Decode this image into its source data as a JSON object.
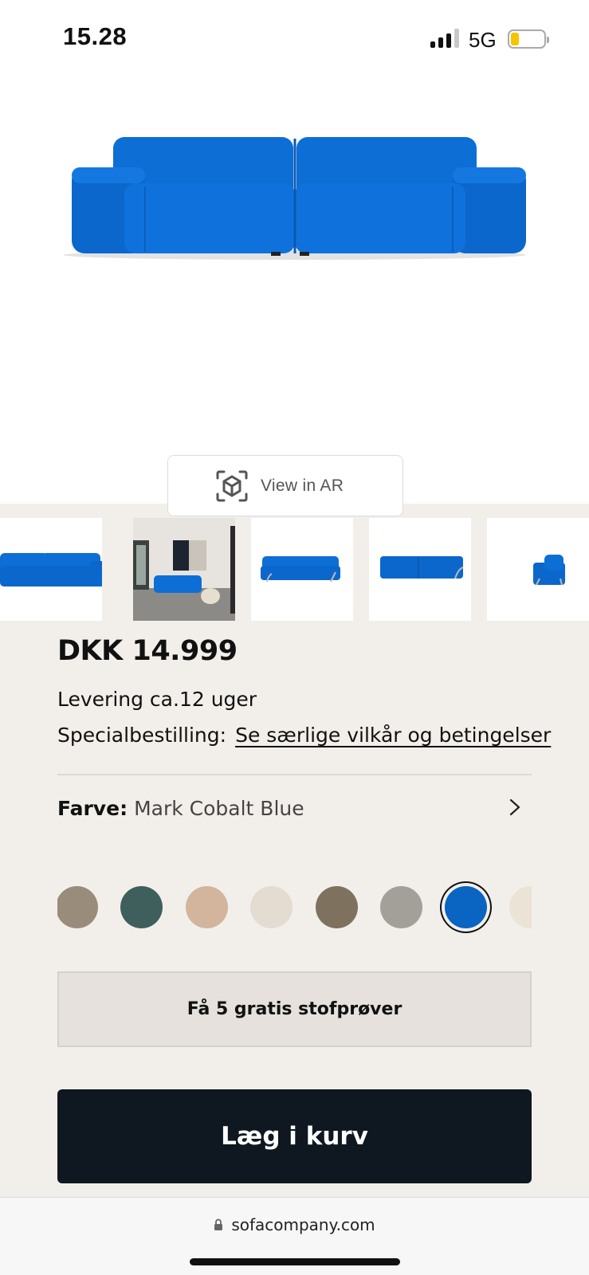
{
  "status_bar": {
    "time": "15.28",
    "network": "5G",
    "battery_level": 0.25,
    "signal_bars": 3,
    "battery_color": "#f6c400"
  },
  "product": {
    "sofa_color": "#0a6fd4",
    "ar_button": {
      "label": "View in AR",
      "icon": "ar-cube-icon"
    },
    "thumbnails": [
      {
        "name": "sofa-front-view"
      },
      {
        "name": "sofa-living-room"
      },
      {
        "name": "sofa-angle-view"
      },
      {
        "name": "sofa-back-view"
      },
      {
        "name": "sofa-side-view"
      }
    ],
    "price": "DKK 14.999",
    "delivery": "Levering ca.12 uger",
    "special_order": {
      "label": "Specialbestilling:",
      "link": "Se særlige vilkår og betingelser"
    },
    "color": {
      "label": "Farve:",
      "value": "Mark Cobalt Blue",
      "icon": "chevron-right-icon"
    },
    "swatches": [
      {
        "name": "taupe",
        "color": "#9a8c7b",
        "selected": false
      },
      {
        "name": "dark-green",
        "color": "#3f5f5c",
        "selected": false
      },
      {
        "name": "sand",
        "color": "#d2b59c",
        "selected": false
      },
      {
        "name": "light-beige",
        "color": "#e4dbd1",
        "selected": false
      },
      {
        "name": "brown-grey",
        "color": "#7e725f",
        "selected": false
      },
      {
        "name": "stone-grey",
        "color": "#a39f99",
        "selected": false
      },
      {
        "name": "cobalt-blue",
        "color": "#0a64c2",
        "selected": true
      },
      {
        "name": "cream",
        "color": "#ebe3d6",
        "selected": false
      }
    ],
    "samples_button": "Få 5 gratis stofprøver",
    "cart_button": "Læg i kurv"
  },
  "browser": {
    "url": "sofacompany.com",
    "icon": "lock-icon"
  }
}
